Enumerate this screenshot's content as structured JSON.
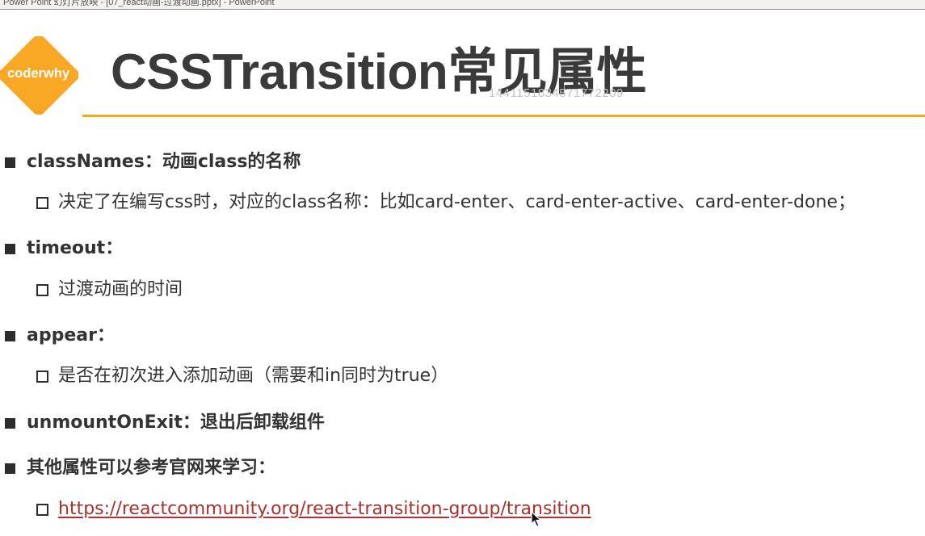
{
  "window_title": "Power Point 幻灯片放映 - [07_react动画-过渡动画.pptx] - PowerPoint",
  "logo": {
    "text": "coderwhy",
    "color": "#f9a825"
  },
  "slide": {
    "title": "CSSTransition常见属性",
    "watermark": "1441151834571772209",
    "accent_color": "#f5a623",
    "items": [
      {
        "text": "classNames：动画class的名称",
        "sub": "决定了在编写css时，对应的class名称：比如card-enter、card-enter-active、card-enter-done；"
      },
      {
        "text": "timeout：",
        "sub": "过渡动画的时间"
      },
      {
        "text": "appear：",
        "sub": "是否在初次进入添加动画（需要和in同时为true）"
      },
      {
        "text": "unmountOnExit：退出后卸载组件"
      },
      {
        "text": "其他属性可以参考官网来学习：",
        "sub_link": "https://reactcommunity.org/react-transition-group/transition"
      }
    ]
  },
  "icons": {
    "bullet": "filled-square-icon",
    "sub_bullet": "hollow-square-icon",
    "cursor": "mouse-pointer-icon"
  }
}
